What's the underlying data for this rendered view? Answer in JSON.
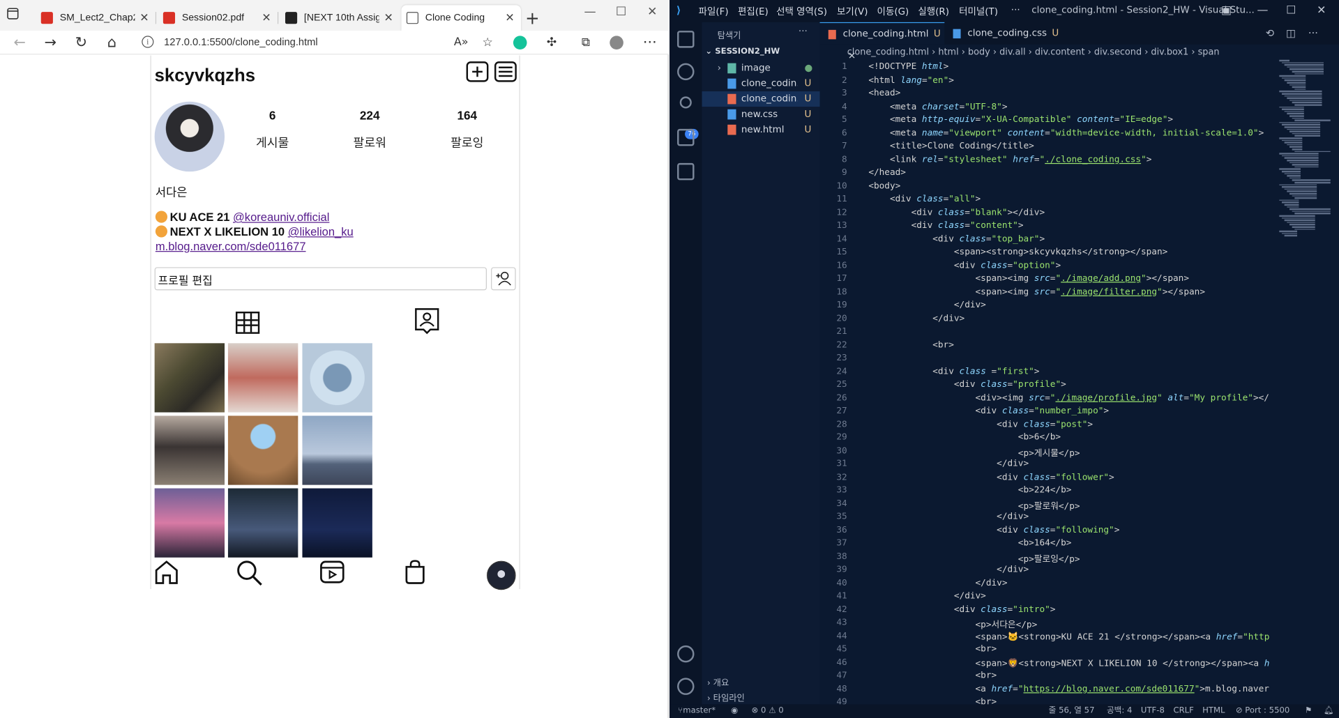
{
  "browser": {
    "tabs": [
      {
        "title": "SM_Lect2_Chap2.pdf",
        "icon": "pdf-icon"
      },
      {
        "title": "Session02.pdf",
        "icon": "pdf-icon"
      },
      {
        "title": "[NEXT 10th Assignm",
        "icon": "github-icon"
      },
      {
        "title": "Clone Coding",
        "icon": "page-icon"
      }
    ],
    "url": "127.0.0.1:5500/clone_coding.html"
  },
  "profile": {
    "username": "skcyvkqzhs",
    "stats": [
      {
        "value": "6",
        "label": "게시물"
      },
      {
        "value": "224",
        "label": "팔로워"
      },
      {
        "value": "164",
        "label": "팔로잉"
      }
    ],
    "name": "서다은",
    "bio1_text": "KU ACE 21 ",
    "bio1_link": "@koreauniv.official",
    "bio2_text": "NEXT X LIKELION 10 ",
    "bio2_link": "@likelion_ku",
    "blog_link": "m.blog.naver.com/sde011677",
    "edit_label": "프로필 편집"
  },
  "vscode": {
    "menu": [
      "파일(F)",
      "편집(E)",
      "선택 영역(S)",
      "보기(V)",
      "이동(G)",
      "실행(R)",
      "터미널(T)",
      "···"
    ],
    "window_title": "clone_coding.html - Session2_HW - Visual Stu...",
    "explorer_title": "탐색기",
    "root": "SESSION2_HW",
    "files": [
      {
        "name": "image",
        "type": "folder",
        "status": "●"
      },
      {
        "name": "clone_codin...",
        "type": "css",
        "status": "U"
      },
      {
        "name": "clone_codin...",
        "type": "html",
        "status": "U"
      },
      {
        "name": "new.css",
        "type": "css",
        "status": "U"
      },
      {
        "name": "new.html",
        "type": "html",
        "status": "U"
      }
    ],
    "outline": "개요",
    "timeline": "타임라인",
    "tabs": [
      {
        "name": "clone_coding.html",
        "status": "U"
      },
      {
        "name": "clone_coding.css",
        "status": "U"
      }
    ],
    "breadcrumb": "clone_coding.html  ›  html  ›  body  ›  div.all  ›  div.content  ›  div.second  ›  div.box1  ›  span",
    "status": {
      "branch": "master*",
      "problems": "⊗ 0 ⚠ 0",
      "position": "줄 56, 열 57",
      "spaces": "공백: 4",
      "encoding": "UTF-8",
      "eol": "CRLF",
      "language": "HTML",
      "port": "⊘ Port : 5500"
    },
    "git_badge": "76"
  }
}
